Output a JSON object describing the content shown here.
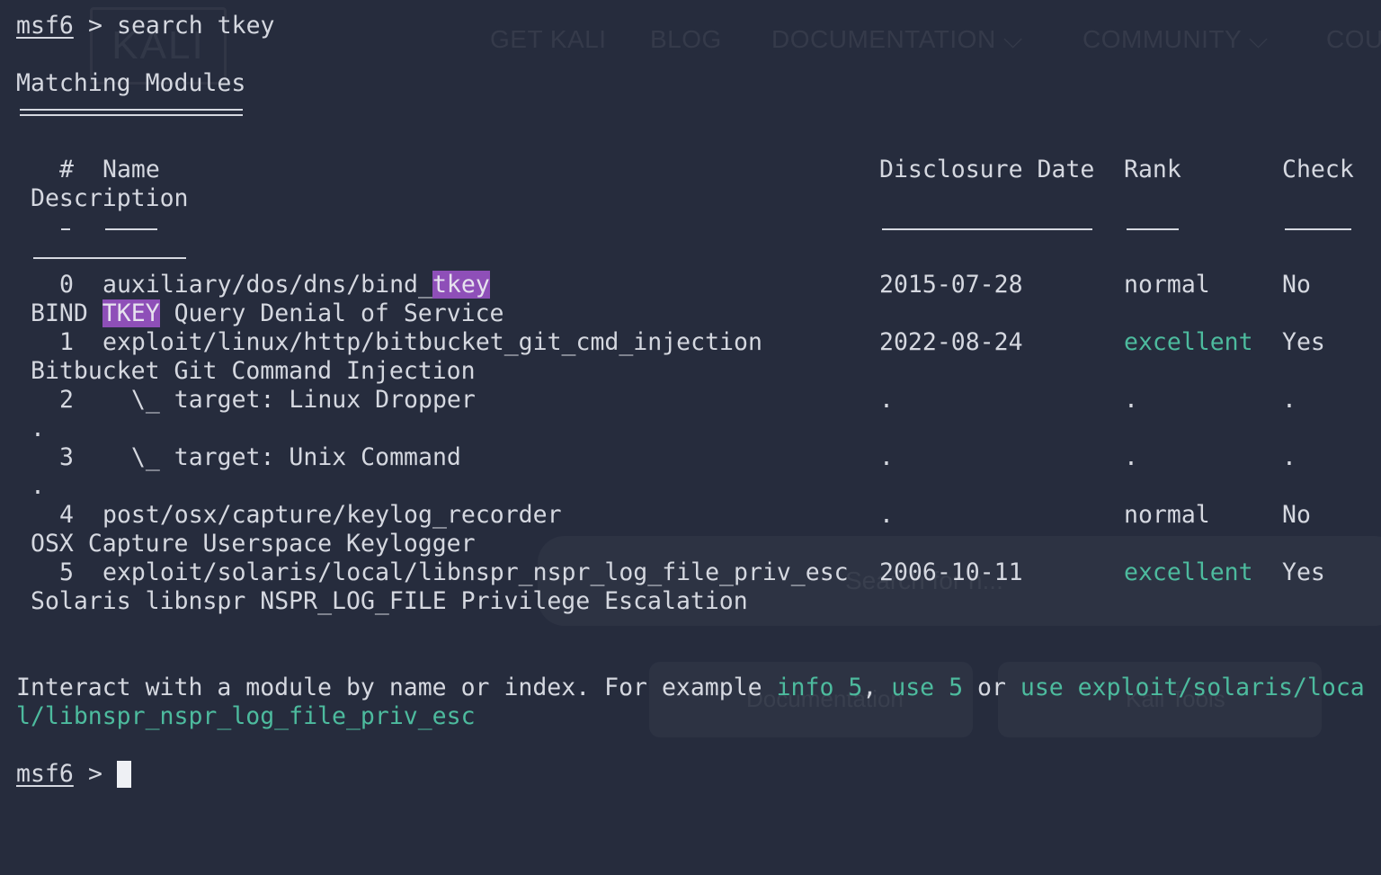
{
  "background": {
    "logo_text": "KALI",
    "nav": [
      "GET KALI",
      "BLOG",
      "DOCUMENTATION ⌵",
      "COMMUNITY ⌵",
      "COU"
    ],
    "search_placeholder": "Search for n...",
    "cards": [
      "Documentation",
      "Kali Tools"
    ]
  },
  "terminal": {
    "prompt": "msf6",
    "prompt_sep": " > ",
    "command": "search tkey",
    "heading": "Matching Modules",
    "headers": {
      "num": "#",
      "name": "Name",
      "date": "Disclosure Date",
      "rank": "Rank",
      "check": "Check",
      "description": "Description"
    },
    "rows": [
      {
        "index": "0",
        "name_pre": "auxiliary/dos/dns/bind_",
        "name_hl": "tkey",
        "date": "2015-07-28",
        "rank": "normal",
        "check": "No",
        "desc_pre": "BIND ",
        "desc_hl": "TKEY",
        "desc_post": " Query Denial of Service"
      },
      {
        "index": "1",
        "name": "exploit/linux/http/bitbucket_git_cmd_injection",
        "date": "2022-08-24",
        "rank": "excellent",
        "check": "Yes",
        "desc": "Bitbucket Git Command Injection"
      },
      {
        "index": "2",
        "name": "  \\_ target: Linux Dropper",
        "date": ".",
        "rank": ".",
        "check": ".",
        "desc": "."
      },
      {
        "index": "3",
        "name": "  \\_ target: Unix Command",
        "date": ".",
        "rank": ".",
        "check": ".",
        "desc": "."
      },
      {
        "index": "4",
        "name": "post/osx/capture/keylog_recorder",
        "date": ".",
        "rank": "normal",
        "check": "No",
        "desc": "OSX Capture Userspace Keylogger"
      },
      {
        "index": "5",
        "name": "exploit/solaris/local/libnspr_nspr_log_file_priv_esc",
        "date": "2006-10-11",
        "rank": "excellent",
        "check": "Yes",
        "desc": "Solaris libnspr NSPR_LOG_FILE Privilege Escalation"
      }
    ],
    "footer": {
      "text1": "Interact with a module by name or index. For example ",
      "ex1": "info 5",
      "sep1": ", ",
      "ex2": "use 5",
      "sep2": " or ",
      "ex3_line1": "use exploit/solaris/loca",
      "ex3_line2": "l/libnspr_nspr_log_file_priv_esc"
    },
    "colors": {
      "background": "#262c3d",
      "text": "#d5d8e0",
      "teal": "#4dbb9e",
      "highlight": "#8e4fb8"
    }
  }
}
